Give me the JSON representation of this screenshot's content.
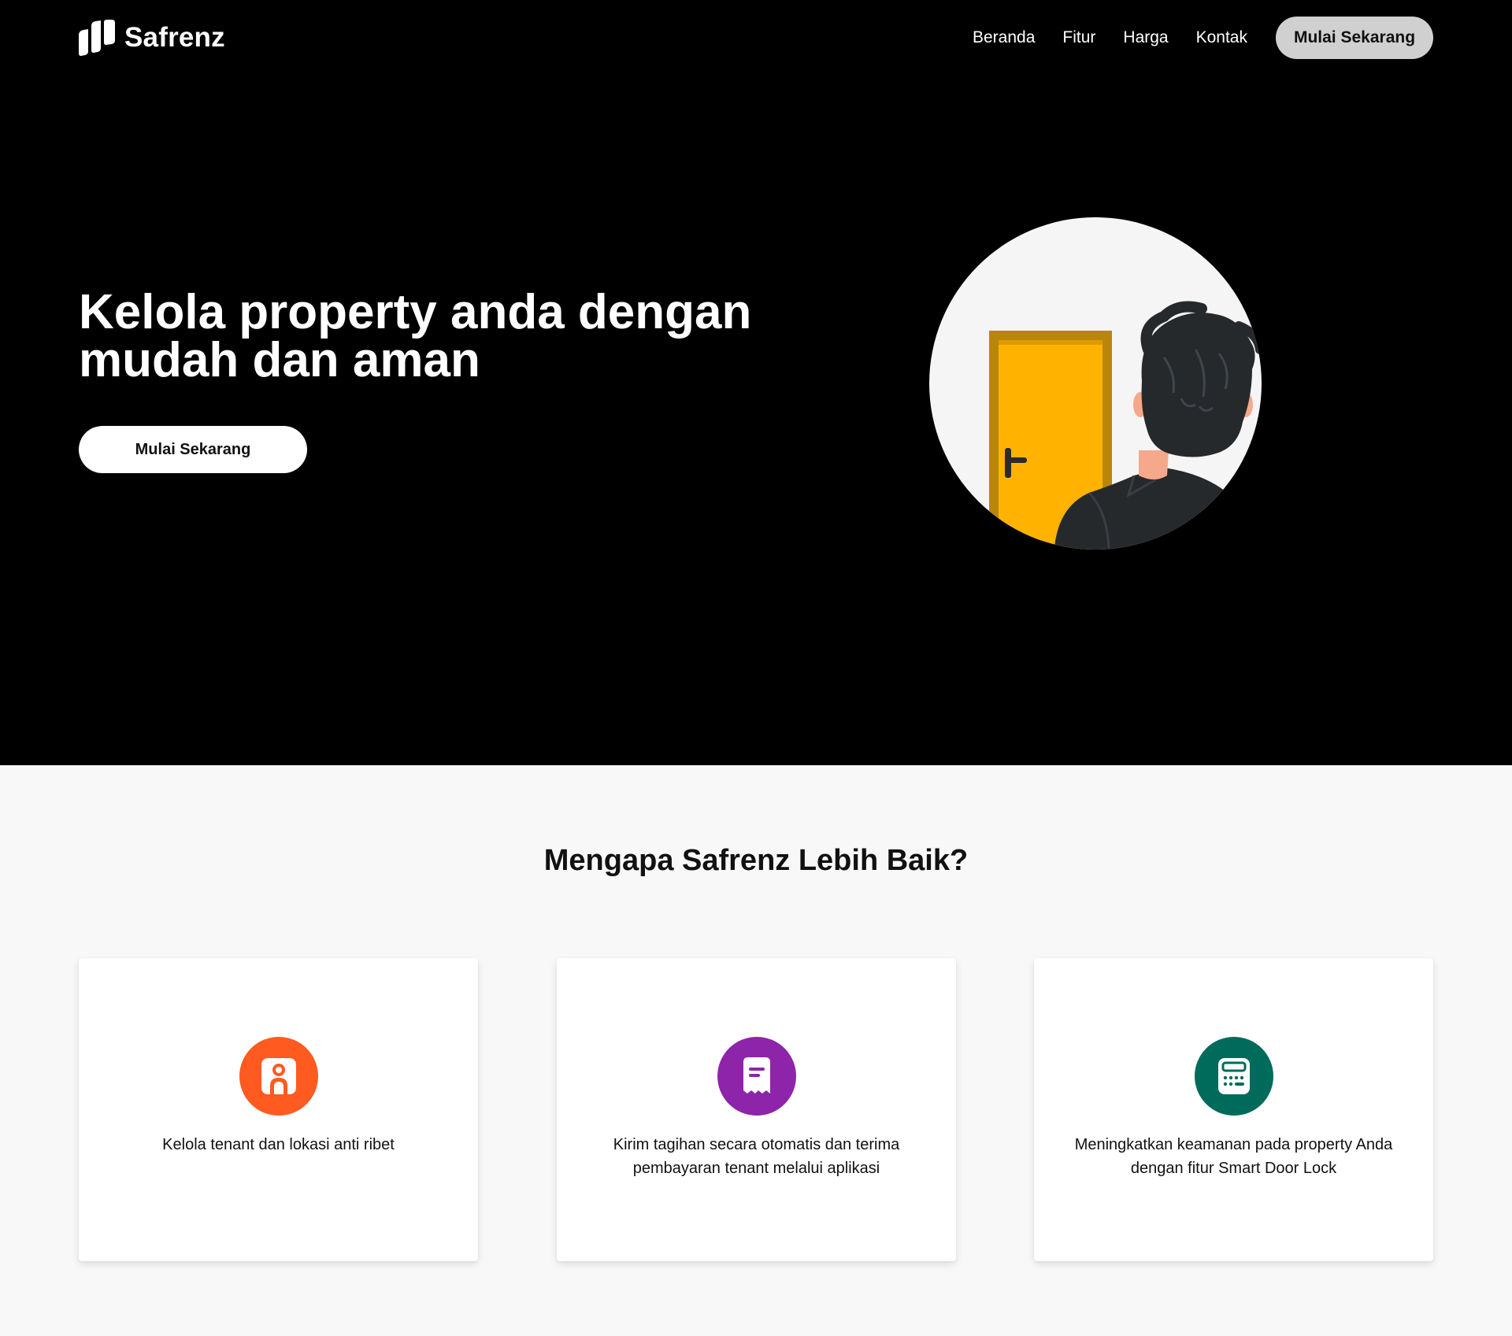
{
  "brand": {
    "name": "Safrenz",
    "logo_icon": "safrenz-logo-icon"
  },
  "nav": {
    "links": [
      "Beranda",
      "Fitur",
      "Harga",
      "Kontak"
    ],
    "cta_label": "Mulai Sekarang"
  },
  "hero": {
    "title": "Kelola property anda dengan mudah dan aman",
    "cta_label": "Mulai Sekarang",
    "illustration": "person-at-door-illustration"
  },
  "features": {
    "title": "Mengapa Safrenz Lebih Baik?",
    "cards": [
      {
        "icon": "tenant-id-icon",
        "color": "#ff5a1f",
        "text": "Kelola tenant dan lokasi anti ribet"
      },
      {
        "icon": "receipt-icon",
        "color": "#8e24aa",
        "text": "Kirim tagihan secara otomatis dan terima pembayaran tenant melalui aplikasi"
      },
      {
        "icon": "keypad-lock-icon",
        "color": "#006b5a",
        "text": "Meningkatkan keamanan pada property Anda dengan fitur Smart Door Lock"
      }
    ]
  },
  "colors": {
    "hero_bg": "#000000",
    "page_bg": "#f8f8f8",
    "nav_cta_bg": "#d0d0d0",
    "door": "#ffb300",
    "door_frame": "#b8860b"
  }
}
